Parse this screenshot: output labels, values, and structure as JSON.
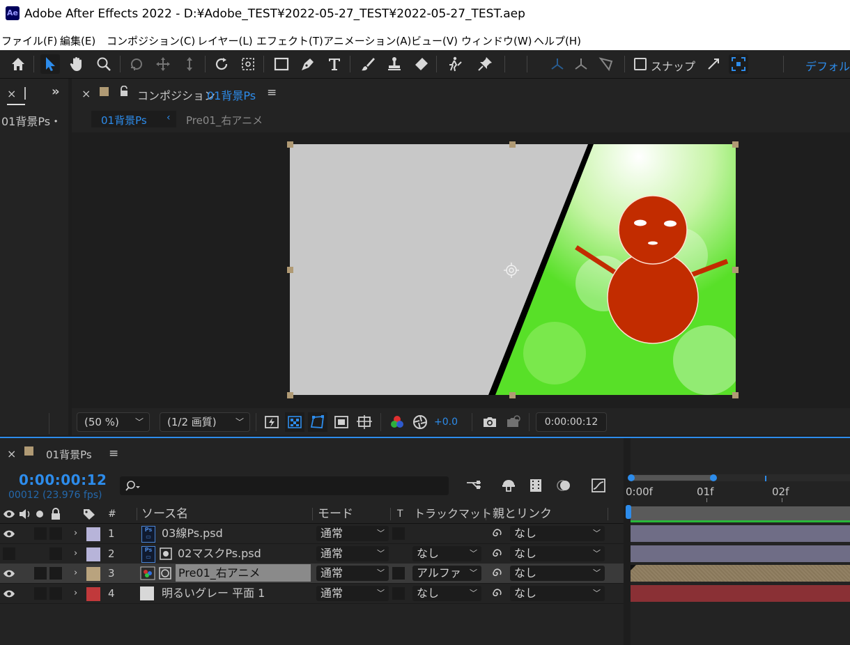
{
  "window": {
    "app_icon": "Ae",
    "title": "Adobe After Effects 2022 - D:¥Adobe_TEST¥2022-05-27_TEST¥2022-05-27_TEST.aep"
  },
  "menu": [
    "ファイル(F)",
    "編集(E)",
    "コンポジション(C)",
    "レイヤー(L)",
    "エフェクト(T)",
    "アニメーション(A)",
    "ビュー(V)",
    "ウィンドウ(W)",
    "ヘルプ(H)"
  ],
  "toolbar": {
    "tools": [
      "home-icon",
      "selection-tool-icon",
      "hand-tool-icon",
      "zoom-tool-icon",
      "orbit-camera-icon",
      "pan-camera-icon",
      "dolly-camera-icon",
      "rotation-tool-icon",
      "pan-behind-icon",
      "rectangle-tool-icon",
      "pen-tool-icon",
      "type-tool-icon",
      "brush-tool-icon",
      "clone-stamp-icon",
      "eraser-icon",
      "roto-brush-icon",
      "puppet-pin-icon"
    ],
    "snap_label": "スナップ",
    "workspace_label": "デフォルト"
  },
  "left_panel": {
    "close": "×",
    "item": "01背景Ps・"
  },
  "comp_panel": {
    "close": "×",
    "label": "コンポジション",
    "comp_name": "01背景Ps",
    "menu_icon": "≡",
    "breadcrumb": [
      "01背景Ps",
      "Pre01_右アニメ"
    ]
  },
  "viewer_footer": {
    "zoom": "(50 %)",
    "resolution": "(1/2 画質)",
    "exposure": "+0.0",
    "timecode": "0:00:00:12"
  },
  "timeline": {
    "close": "×",
    "comp_name": "01背景Ps",
    "menu_icon": "≡",
    "current_time": "0:00:00:12",
    "frame_info": "00012 (23.976 fps)",
    "search_icon": "search-icon",
    "ruler": [
      "0:00f",
      "01f",
      "02f"
    ],
    "columns": {
      "num": "#",
      "source": "ソース名",
      "mode": "モード",
      "t": "T",
      "trackmatte": "トラックマット",
      "parent": "親とリンク"
    },
    "layers": [
      {
        "num": "1",
        "name": "03線Ps.psd",
        "mode": "通常",
        "matte": "",
        "parent": "なし",
        "label_color": "#b7b4d9",
        "bar_color": "#6f6d86",
        "visible": true
      },
      {
        "num": "2",
        "name": "02マスクPs.psd",
        "mode": "通常",
        "matte": "なし",
        "parent": "なし",
        "label_color": "#b7b4d9",
        "bar_color": "#6f6d86",
        "visible": false
      },
      {
        "num": "3",
        "name": "Pre01_右アニメ",
        "mode": "通常",
        "matte": "アルファ",
        "parent": "なし",
        "label_color": "#b9a37e",
        "bar_color": "#8e7c5e",
        "visible": true
      },
      {
        "num": "4",
        "name": "明るいグレー 平面 1",
        "mode": "通常",
        "matte": "なし",
        "parent": "なし",
        "label_color": "#c1393b",
        "bar_color": "#8a3035",
        "visible": true
      }
    ]
  }
}
